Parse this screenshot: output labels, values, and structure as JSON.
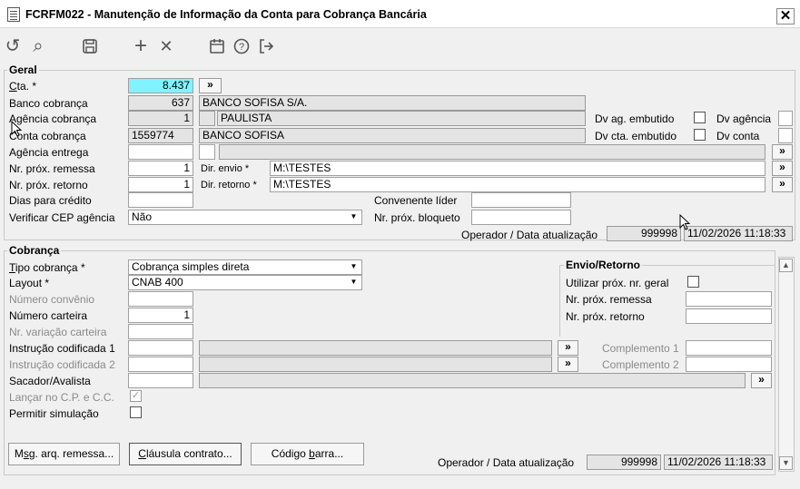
{
  "window": {
    "title": "FCRFM022 - Manutenção de Informação da Conta para Cobrança Bancária",
    "close_glyph": "✕"
  },
  "toolbar": {
    "refresh_icon": "↺",
    "search_icon": "⌕",
    "save_icon": "▭",
    "add_icon": "+",
    "delete_icon": "✕",
    "calendar_icon": "▦",
    "help_icon": "?",
    "exit_icon": "⇥"
  },
  "geral": {
    "title": "Geral",
    "cta_label": "Cta. *",
    "cta_value": "8.437",
    "more_btn": "»",
    "banco_label": "Banco cobrança",
    "banco_code": "637",
    "banco_name": "BANCO SOFISA S/A.",
    "agencia_label": "Agência cobrança",
    "agencia_code": "1",
    "agencia_dv": "",
    "agencia_name": "PAULISTA",
    "dv_ag_embutido_label": "Dv ag. embutido",
    "dv_agencia_label": "Dv agência",
    "conta_label": "Conta cobrança",
    "conta_code": "1559774",
    "conta_name": "BANCO SOFISA",
    "dv_cta_embutido_label": "Dv cta. embutido",
    "dv_conta_label": "Dv conta",
    "agencia_entrega_label": "Agência entrega",
    "prox_remessa_label": "Nr. próx. remessa",
    "prox_remessa_value": "1",
    "dir_envio_label": "Dir. envio *",
    "dir_envio_value": "M:\\TESTES",
    "prox_retorno_label": "Nr. próx. retorno",
    "prox_retorno_value": "1",
    "dir_retorno_label": "Dir. retorno *",
    "dir_retorno_value": "M:\\TESTES",
    "dias_credito_label": "Dias para crédito",
    "convenente_label": "Convenente líder",
    "verificar_cep_label": "Verificar CEP agência",
    "verificar_cep_value": "Não",
    "prox_bloqueto_label": "Nr. próx. bloqueto",
    "operador_label": "Operador / Data atualização",
    "operador_value": "999998",
    "data_value": "11/02/2026 11:18:33"
  },
  "cobranca": {
    "title": "Cobrança",
    "tipo_label": "Tipo cobrança *",
    "tipo_value": "Cobrança simples direta",
    "layout_label": "Layout *",
    "layout_value": "CNAB 400",
    "numero_convenio_label": "Número convênio",
    "numero_carteira_label": "Número carteira",
    "numero_carteira_value": "1",
    "variacao_label": "Nr. variação carteira",
    "instr1_label": "Instrução codificada 1",
    "instr2_label": "Instrução codificada 2",
    "complemento1_label": "Complemento 1",
    "complemento2_label": "Complemento 2",
    "sacador_label": "Sacador/Avalista",
    "lancar_label": "Lançar no C.P. e C.C.",
    "permitir_label": "Permitir simulação",
    "envio_title": "Envio/Retorno",
    "utilizar_label": "Utilizar próx. nr. geral",
    "env_remessa_label": "Nr. próx. remessa",
    "env_retorno_label": "Nr. próx. retorno",
    "btn_msg": "Msg. arq. remessa...",
    "btn_clausula": "Cláusula contrato...",
    "btn_codigo": "Código barra...",
    "operador_label": "Operador / Data atualização",
    "operador_value": "999998",
    "data_value": "11/02/2026 11:18:33"
  }
}
